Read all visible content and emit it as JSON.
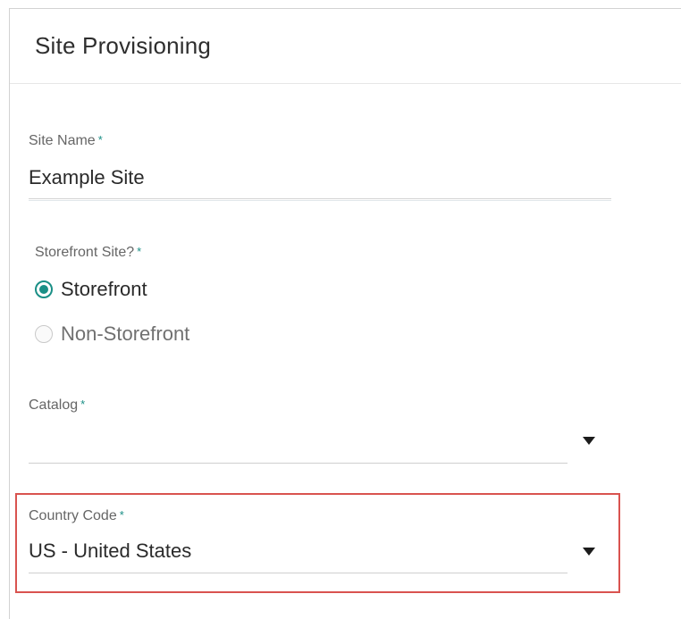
{
  "header": {
    "title": "Site Provisioning"
  },
  "form": {
    "site_name": {
      "label": "Site Name",
      "required_mark": "*",
      "value": "Example Site"
    },
    "storefront": {
      "label": "Storefront Site?",
      "required_mark": "*",
      "options": [
        {
          "label": "Storefront",
          "selected": true
        },
        {
          "label": "Non-Storefront",
          "selected": false
        }
      ]
    },
    "catalog": {
      "label": "Catalog",
      "required_mark": "*",
      "value": ""
    },
    "country_code": {
      "label": "Country Code",
      "required_mark": "*",
      "value": "US - United States"
    }
  },
  "colors": {
    "accent": "#1a8f86",
    "highlight_border": "#d9534f"
  },
  "icons": {
    "dropdown": "caret-down-icon",
    "radio_selected": "radio-selected-icon",
    "radio_unselected": "radio-unselected-icon"
  }
}
